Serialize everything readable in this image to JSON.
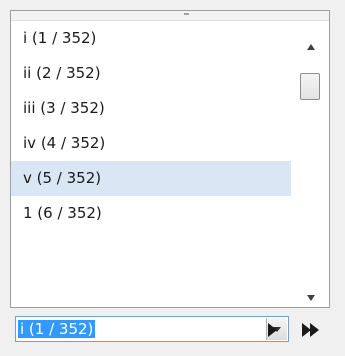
{
  "pages": {
    "items": [
      {
        "label": "i (1 / 352)"
      },
      {
        "label": "ii (2 / 352)"
      },
      {
        "label": "iii (3 / 352)"
      },
      {
        "label": "iv (4 / 352)"
      },
      {
        "label": "v (5 / 352)"
      },
      {
        "label": "1 (6 / 352)"
      }
    ],
    "hovered_index": 4
  },
  "combo": {
    "value": "i (1 / 352)"
  },
  "icons": {
    "scroll_up": "triangle-up-icon",
    "scroll_down": "triangle-down-icon",
    "combo_dropdown": "chevron-down-icon",
    "next": "play-icon",
    "last": "fast-forward-icon"
  },
  "colors": {
    "hover_bg": "#d9e6f3",
    "selection_bg": "#3399ff"
  }
}
